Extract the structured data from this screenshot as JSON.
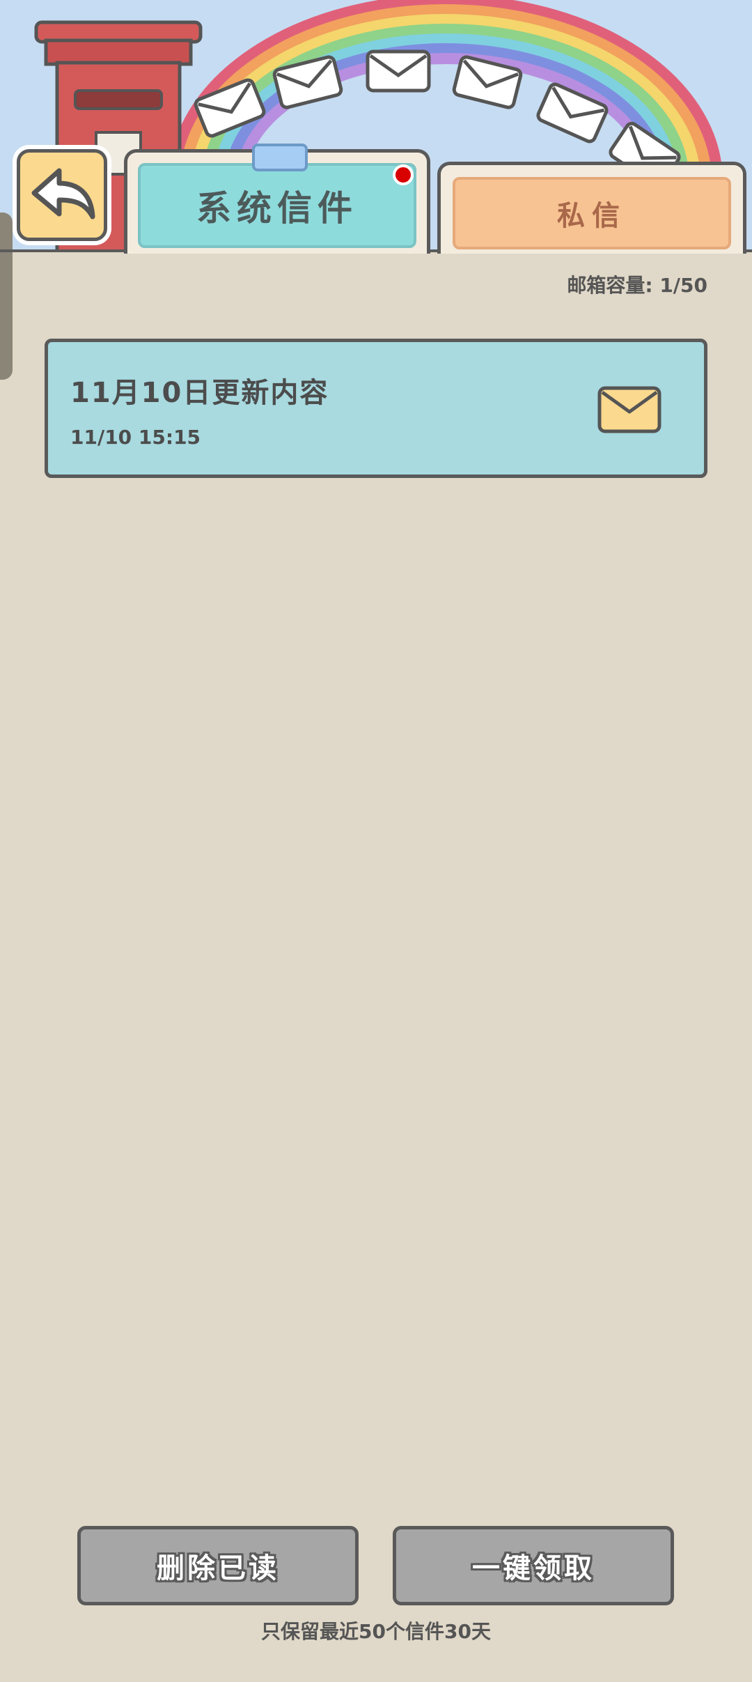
{
  "header": {
    "back_icon": "back-arrow-icon",
    "mailbox_icon": "postbox-icon",
    "decoration": "rainbow-with-envelopes"
  },
  "tabs": [
    {
      "label": "系统信件",
      "active": true,
      "has_notification": true,
      "color": "#8edbdc"
    },
    {
      "label": "私信",
      "active": false,
      "color": "#f7c393"
    }
  ],
  "mailbox": {
    "capacity_text": "邮箱容量: 1/50"
  },
  "mails": [
    {
      "title": "11月10日更新内容",
      "time": "11/10 15:15",
      "icon": "envelope-icon",
      "read": false
    }
  ],
  "actions": {
    "delete_read_label": "删除已读",
    "claim_all_label": "一键领取"
  },
  "footer": {
    "note": "只保留最近50个信件30天"
  },
  "colors": {
    "background": "#e0d8c8",
    "mail_item": "#a8dae0",
    "button": "#a6a6a6",
    "notification": "#d90000"
  }
}
